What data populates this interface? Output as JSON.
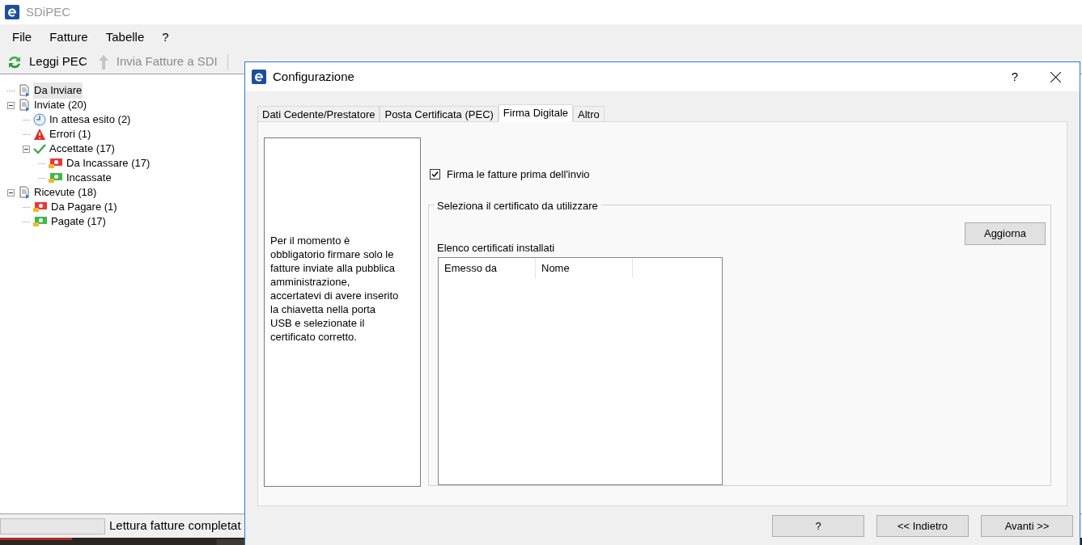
{
  "window": {
    "title": "SDiPEC"
  },
  "menu": [
    "File",
    "Fatture",
    "Tabelle",
    "?"
  ],
  "toolbar": [
    {
      "label": "Leggi PEC",
      "kind": "refresh",
      "disabled": false
    },
    {
      "label": "Invia Fatture a SDI",
      "kind": "upload",
      "disabled": true
    }
  ],
  "tree": [
    {
      "label": "Da Inviare",
      "kind": "document",
      "selected": true
    },
    {
      "label": "Inviate (20)",
      "kind": "document",
      "selected": false,
      "expanded": true,
      "children": [
        {
          "label": "In attesa esito (2)",
          "kind": "clock",
          "selected": false
        },
        {
          "label": "Errori (1)",
          "kind": "warning",
          "selected": false
        },
        {
          "label": "Accettate (17)",
          "kind": "check",
          "selected": false,
          "expanded": true,
          "children": [
            {
              "label": "Da Incassare (17)",
              "kind": "unpaid",
              "selected": false
            },
            {
              "label": "Incassate",
              "kind": "paid",
              "selected": false
            }
          ]
        }
      ]
    },
    {
      "label": "Ricevute (18)",
      "kind": "document",
      "selected": false,
      "expanded": true,
      "children": [
        {
          "label": "Da Pagare (1)",
          "kind": "unpaid",
          "selected": false
        },
        {
          "label": "Pagate (17)",
          "kind": "paid",
          "selected": false
        }
      ]
    }
  ],
  "status_bar": {
    "text": "Lettura fatture completat",
    "level": 0
  },
  "dialog": {
    "title": "Configurazione",
    "help": "?",
    "tabs": [
      {
        "label": "Dati Cedente/Prestatore",
        "selected": false
      },
      {
        "label": "Posta Certificata (PEC)",
        "selected": false
      },
      {
        "label": "Firma Digitale",
        "selected": true
      },
      {
        "label": "Altro",
        "selected": false
      }
    ],
    "info": "Per il momento è obbligatorio firmare solo le fatture inviate alla pubblica amministrazione, accertatevi di avere inserito la chiavetta nella porta USB e selezionate il certificato corretto.",
    "sign_checkbox": {
      "label": "Firma le fatture prima dell'invio",
      "checked": true
    },
    "certificate_group": {
      "legend": "Seleziona il certificato da utilizzare",
      "refresh_button": "Aggiorna",
      "list_label": "Elenco certificati installati",
      "columns": [
        "Emesso da",
        "Nome"
      ]
    },
    "buttons": [
      "?",
      "<< Indietro",
      "Avanti >>"
    ]
  }
}
